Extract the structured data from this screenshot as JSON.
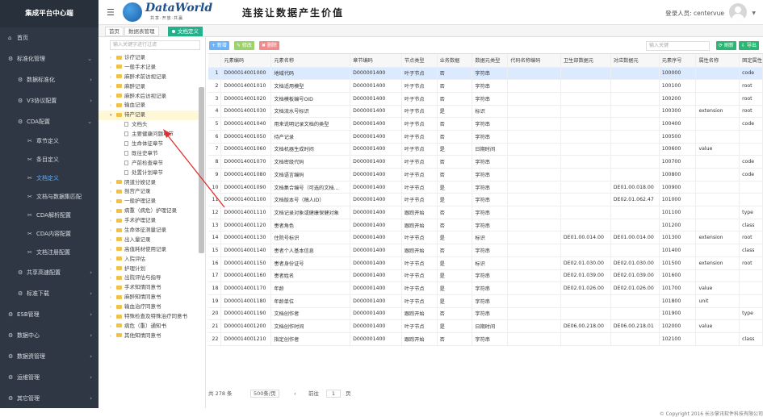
{
  "sidebar": {
    "title": "集成平台中心端",
    "items": [
      {
        "label": "首页",
        "icon": "home-icon",
        "level": 0
      },
      {
        "label": "标准化管理",
        "icon": "gear-icon",
        "level": 0,
        "arrow": "v"
      },
      {
        "label": "数据标准化",
        "icon": "gear-icon",
        "level": 1,
        "arrow": ">"
      },
      {
        "label": "V3协议配置",
        "icon": "gear-icon",
        "level": 1,
        "arrow": ">"
      },
      {
        "label": "CDA配置",
        "icon": "gear-icon",
        "level": 1,
        "arrow": "v"
      },
      {
        "label": "章节定义",
        "icon": "scissors-icon",
        "level": 2
      },
      {
        "label": "条目定义",
        "icon": "scissors-icon",
        "level": 2
      },
      {
        "label": "文档定义",
        "icon": "scissors-icon",
        "level": 2,
        "active": true
      },
      {
        "label": "文档与数据集匹配",
        "icon": "scissors-icon",
        "level": 2
      },
      {
        "label": "CDA解析配置",
        "icon": "scissors-icon",
        "level": 2
      },
      {
        "label": "CDA内容配置",
        "icon": "scissors-icon",
        "level": 2
      },
      {
        "label": "文档注册配置",
        "icon": "scissors-icon",
        "level": 2
      },
      {
        "label": "共享高速配置",
        "icon": "gear-icon",
        "level": 1,
        "arrow": ">"
      },
      {
        "label": "标准下载",
        "icon": "gear-icon",
        "level": 1,
        "arrow": ">"
      },
      {
        "label": "ESB管理",
        "icon": "gear-icon",
        "level": 0,
        "arrow": ">"
      },
      {
        "label": "数据中心",
        "icon": "gear-icon",
        "level": 0,
        "arrow": ">"
      },
      {
        "label": "数据资管理",
        "icon": "gear-icon",
        "level": 0,
        "arrow": ">"
      },
      {
        "label": "运维管理",
        "icon": "gear-icon",
        "level": 0,
        "arrow": ">"
      },
      {
        "label": "其它管理",
        "icon": "gear-icon",
        "level": 0,
        "arrow": ">"
      }
    ]
  },
  "header": {
    "brand": "DataWorld",
    "brand_sub": "共享·开放·共赢",
    "slogan": "连接让数据产生价值",
    "login_label": "登录人员: centervue"
  },
  "tabs": [
    {
      "label": "首页"
    },
    {
      "label": "数据表管理"
    },
    {
      "label": "文档定义",
      "active": true
    }
  ],
  "tree": {
    "search_placeholder": "输入关键字进行过滤",
    "nodes": [
      {
        "label": "诊疗记录",
        "type": "folder",
        "level": 0,
        "exp": ">"
      },
      {
        "label": "一般手术记录",
        "type": "folder",
        "level": 0,
        "exp": ">"
      },
      {
        "label": "麻醉术前访视记录",
        "type": "folder",
        "level": 0,
        "exp": ">"
      },
      {
        "label": "麻醉记录",
        "type": "folder",
        "level": 0,
        "exp": ">"
      },
      {
        "label": "麻醉术后访视记录",
        "type": "folder",
        "level": 0,
        "exp": ">"
      },
      {
        "label": "输血记录",
        "type": "folder",
        "level": 0,
        "exp": ">"
      },
      {
        "label": "待产记录",
        "type": "folder",
        "level": 0,
        "exp": "v",
        "selected": true
      },
      {
        "label": "文档头",
        "type": "doc",
        "level": 1
      },
      {
        "label": "主要健康问题章节",
        "type": "doc",
        "level": 1
      },
      {
        "label": "生命体征章节",
        "type": "doc",
        "level": 1
      },
      {
        "label": "既往史章节",
        "type": "doc",
        "level": 1
      },
      {
        "label": "产前检查章节",
        "type": "doc",
        "level": 1
      },
      {
        "label": "处置计划章节",
        "type": "doc",
        "level": 1
      },
      {
        "label": "阴道分娩记录",
        "type": "folder",
        "level": 0,
        "exp": ">"
      },
      {
        "label": "剖宫产记录",
        "type": "folder",
        "level": 0,
        "exp": ">"
      },
      {
        "label": "一般护理记录",
        "type": "folder",
        "level": 0,
        "exp": ">"
      },
      {
        "label": "病重（病危）护理记录",
        "type": "folder",
        "level": 0,
        "exp": ">"
      },
      {
        "label": "手术护理记录",
        "type": "folder",
        "level": 0,
        "exp": ">"
      },
      {
        "label": "生命体征测量记录",
        "type": "folder",
        "level": 0,
        "exp": ">"
      },
      {
        "label": "出入量记录",
        "type": "folder",
        "level": 0,
        "exp": ">"
      },
      {
        "label": "高值耗材使用记录",
        "type": "folder",
        "level": 0,
        "exp": ">"
      },
      {
        "label": "入院评估",
        "type": "folder",
        "level": 0,
        "exp": ">"
      },
      {
        "label": "护理计划",
        "type": "folder",
        "level": 0,
        "exp": ">"
      },
      {
        "label": "出院评估与指导",
        "type": "folder",
        "level": 0,
        "exp": ">"
      },
      {
        "label": "手术知情同意书",
        "type": "folder",
        "level": 0,
        "exp": ">"
      },
      {
        "label": "麻醉知情同意书",
        "type": "folder",
        "level": 0,
        "exp": ">"
      },
      {
        "label": "输血治疗同意书",
        "type": "folder",
        "level": 0,
        "exp": ">"
      },
      {
        "label": "特殊检查及特殊治疗同意书",
        "type": "folder",
        "level": 0,
        "exp": ">"
      },
      {
        "label": "病危（重）通知书",
        "type": "folder",
        "level": 0,
        "exp": ">"
      },
      {
        "label": "其他知情同意书",
        "type": "folder",
        "level": 0,
        "exp": ">"
      }
    ]
  },
  "toolbar": {
    "add": "+ 新增",
    "edit": "✎ 修改",
    "del": "✖ 删除",
    "search_placeholder": "输入关键",
    "refresh": "⟳ 刷新",
    "export": "⇩ 导出",
    "colors": {
      "add": "#6cb4f5",
      "edit": "#9bd36a",
      "del": "#f08b8b",
      "refresh": "#2bb673",
      "export": "#2bb673"
    }
  },
  "grid": {
    "headers": [
      "",
      "元素编码",
      "元素名称",
      "章节编码",
      "节点类型",
      "业务数据",
      "数据元类型",
      "代码名称编码",
      "卫生部数据元",
      "对应数据元",
      "元素序号",
      "属性名称",
      "固定属性"
    ],
    "rows": [
      [
        "1",
        "D000014001000",
        "地域代码",
        "D000001400",
        "叶子节点",
        "否",
        "字符串",
        "",
        "",
        "",
        "100000",
        "",
        "code"
      ],
      [
        "2",
        "D000014001010",
        "文档适用模型",
        "D000001400",
        "叶子节点",
        "否",
        "字符串",
        "",
        "",
        "",
        "100100",
        "",
        "root"
      ],
      [
        "3",
        "D000014001020",
        "文档模板编号OID",
        "D000001400",
        "叶子节点",
        "否",
        "字符串",
        "",
        "",
        "",
        "100200",
        "",
        "root"
      ],
      [
        "4",
        "D000014001030",
        "文档流水号标识",
        "D000001400",
        "叶子节点",
        "是",
        "标识",
        "",
        "",
        "",
        "100300",
        "extension",
        "root"
      ],
      [
        "5",
        "D000014001040",
        "用来说明记录文档的类型",
        "D000001400",
        "叶子节点",
        "否",
        "字符串",
        "",
        "",
        "",
        "100400",
        "",
        "code"
      ],
      [
        "6",
        "D000014001050",
        "待产记录",
        "D000001400",
        "叶子节点",
        "否",
        "字符串",
        "",
        "",
        "",
        "100500",
        "",
        ""
      ],
      [
        "7",
        "D000014001060",
        "文档机器生成时间",
        "D000001400",
        "叶子节点",
        "是",
        "日期时间",
        "",
        "",
        "",
        "100600",
        "value",
        ""
      ],
      [
        "8",
        "D000014001070",
        "文档密级代码",
        "D000001400",
        "叶子节点",
        "否",
        "字符串",
        "",
        "",
        "",
        "100700",
        "",
        "code"
      ],
      [
        "9",
        "D000014001080",
        "文档语言编码",
        "D000001400",
        "叶子节点",
        "否",
        "字符串",
        "",
        "",
        "",
        "100800",
        "",
        "code"
      ],
      [
        "10",
        "D000014001090",
        "文档集合编号（可选的文档...",
        "D000001400",
        "叶子节点",
        "是",
        "字符串",
        "",
        "",
        "DE01.00.018.00",
        "100900",
        "",
        ""
      ],
      [
        "11",
        "D000014001100",
        "文档版本号（稿人ID）",
        "D000001400",
        "叶子节点",
        "是",
        "字符串",
        "",
        "",
        "DE02.01.062.47",
        "101000",
        "",
        ""
      ],
      [
        "12",
        "D000014001110",
        "文档记录对象或健康保健对象",
        "D000001400",
        "跟踪开始",
        "否",
        "字符串",
        "",
        "",
        "",
        "101100",
        "",
        "type"
      ],
      [
        "13",
        "D000014001120",
        "患者角色",
        "D000001400",
        "跟踪开始",
        "否",
        "字符串",
        "",
        "",
        "",
        "101200",
        "",
        "class"
      ],
      [
        "14",
        "D000014001130",
        "住院号标识",
        "D000001400",
        "叶子节点",
        "是",
        "标识",
        "",
        "DE01.00.014.00",
        "DE01.00.014.00",
        "101300",
        "extension",
        "root"
      ],
      [
        "15",
        "D000014001140",
        "患者个人基本信息",
        "D000001400",
        "跟踪开始",
        "否",
        "字符串",
        "",
        "",
        "",
        "101400",
        "",
        "class"
      ],
      [
        "16",
        "D000014001150",
        "患者身份证号",
        "D000001400",
        "叶子节点",
        "是",
        "标识",
        "",
        "DE02.01.030.00",
        "DE02.01.030.00",
        "101500",
        "extension",
        "root"
      ],
      [
        "17",
        "D000014001160",
        "患者姓名",
        "D000001400",
        "叶子节点",
        "是",
        "字符串",
        "",
        "DE02.01.039.00",
        "DE02.01.039.00",
        "101600",
        "",
        ""
      ],
      [
        "18",
        "D000014001170",
        "年龄",
        "D000001400",
        "叶子节点",
        "是",
        "字符串",
        "",
        "DE02.01.026.00",
        "DE02.01.026.00",
        "101700",
        "value",
        ""
      ],
      [
        "19",
        "D000014001180",
        "年龄单位",
        "D000001400",
        "叶子节点",
        "是",
        "字符串",
        "",
        "",
        "",
        "101800",
        "unit",
        ""
      ],
      [
        "20",
        "D000014001190",
        "文档创作者",
        "D000001400",
        "跟踪开始",
        "否",
        "字符串",
        "",
        "",
        "",
        "101900",
        "",
        "type"
      ],
      [
        "21",
        "D000014001200",
        "文档创作时间",
        "D000001400",
        "叶子节点",
        "是",
        "日期时间",
        "",
        "DE06.00.218.00",
        "DE06.00.218.01",
        "102000",
        "value",
        ""
      ],
      [
        "22",
        "D000014001210",
        "指定创作者",
        "D000001400",
        "跟踪开始",
        "否",
        "字符串",
        "",
        "",
        "",
        "102100",
        "",
        "class"
      ]
    ]
  },
  "footer": {
    "total": "共 278 条",
    "page_size": "500条/页",
    "prev": "前往",
    "page": "1",
    "page_suffix": "页",
    "copyright": "© Copyright 2016 长沙掌讯软件科技有限公司"
  }
}
